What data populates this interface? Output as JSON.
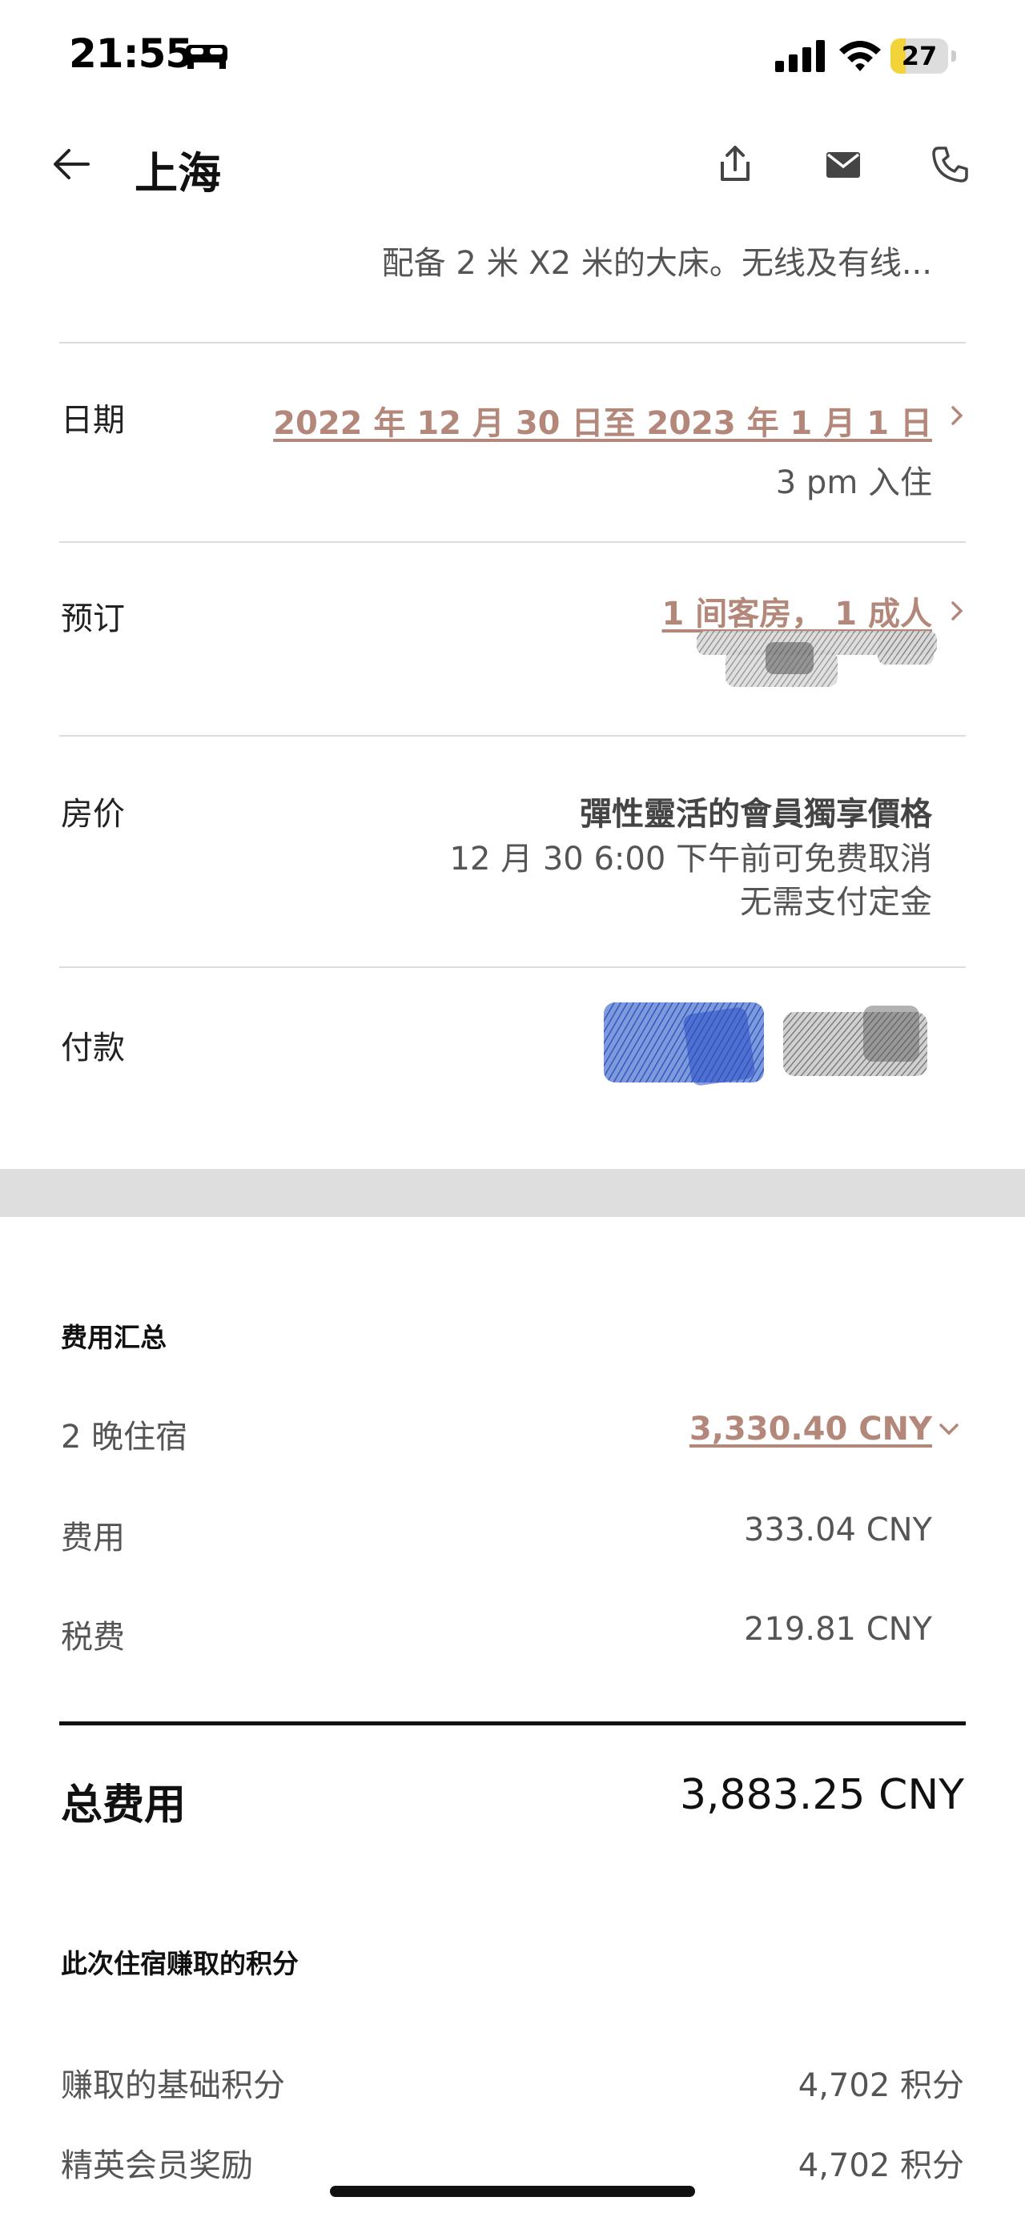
{
  "status": {
    "time": "21:55",
    "battery": "27",
    "battery_level": 0.27,
    "icons": [
      "bed-icon",
      "signal-icon",
      "wifi-icon",
      "battery-icon"
    ]
  },
  "header": {
    "title": "上海",
    "icons": [
      "back-arrow-icon",
      "share-icon",
      "mail-icon",
      "phone-icon"
    ]
  },
  "room": {
    "description": "配备 2 米 X2 米的大床。无线及有线..."
  },
  "date_row": {
    "label": "日期",
    "value": "2022 年 12 月 30 日至 2023 年 1 月 1 日",
    "checkin": "3 pm 入住"
  },
  "booking_row": {
    "label": "预订",
    "value": "1 间客房，  1 成人"
  },
  "rate_row": {
    "label": "房价",
    "rate_name": "彈性靈活的會員獨享價格",
    "cancel": "12 月 30 6:00 下午前可免费取消",
    "deposit": "无需支付定金"
  },
  "payment_row": {
    "label": "付款"
  },
  "summary": {
    "title": "费用汇总",
    "nights_label": "2 晚住宿",
    "nights_value": "3,330.40 CNY",
    "fees_label": "费用",
    "fees_value": "333.04 CNY",
    "tax_label": "税费",
    "tax_value": "219.81 CNY",
    "total_label": "总费用",
    "total_value": "3,883.25 CNY"
  },
  "points": {
    "title": "此次住宿赚取的积分",
    "base_label": "赚取的基础积分",
    "base_value": "4,702 积分",
    "elite_label": "精英会员奖励",
    "elite_value": "4,702 积分"
  },
  "colors": {
    "accent": "#b3887a",
    "battery": "#f2d43a",
    "divider": "#dcdcdc",
    "section_bar": "#dedede"
  }
}
